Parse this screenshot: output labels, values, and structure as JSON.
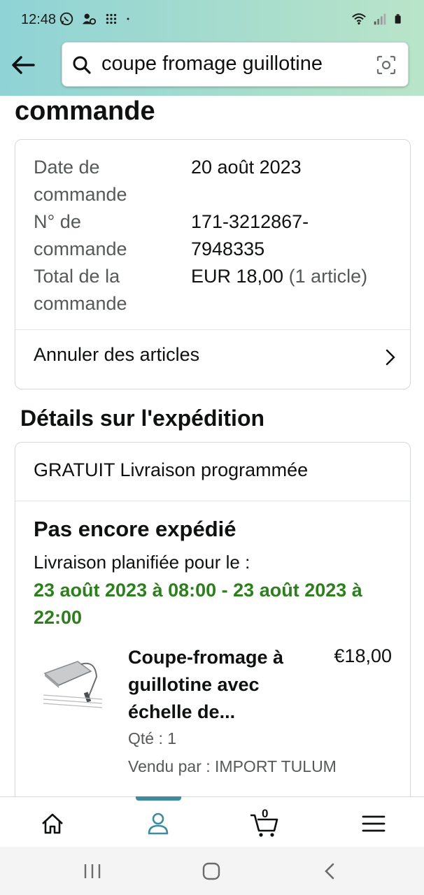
{
  "status_bar": {
    "time": "12:48"
  },
  "search": {
    "query": "coupe fromage guillotine"
  },
  "page": {
    "heading": "commande"
  },
  "order_summary": {
    "rows": [
      {
        "label_line1": "Date de",
        "label_line2": "commande",
        "value": "20 août 2023"
      },
      {
        "label_line1": "N° de",
        "label_line2": "commande",
        "value_line1": "171-3212867-",
        "value_line2": "7948335"
      },
      {
        "label_line1": "Total de la",
        "label_line2": "commande",
        "value_main": "EUR 18,00",
        "value_paren": "(1 article)"
      }
    ],
    "cancel_label": "Annuler des articles"
  },
  "shipping": {
    "section_title": "Détails sur l'expédition",
    "method": "GRATUIT Livraison programmée",
    "status": "Pas encore expédié",
    "planned_label": "Livraison planifiée pour le :",
    "planned_dates": "23 août 2023 à 08:00 - 23 août 2023 à 22:00"
  },
  "item": {
    "title": "Coupe-fromage à guillotine avec échelle de...",
    "price": "€18,00",
    "quantity": "Qté : 1",
    "seller": "Vendu par : IMPORT TULUM"
  },
  "bottom_nav": {
    "cart_count": "0",
    "active_tab": "you"
  },
  "colors": {
    "header_gradient_start": "#8fd3d6",
    "delivery_green": "#2d7f1e",
    "nav_indicator": "#3e8a9e"
  }
}
